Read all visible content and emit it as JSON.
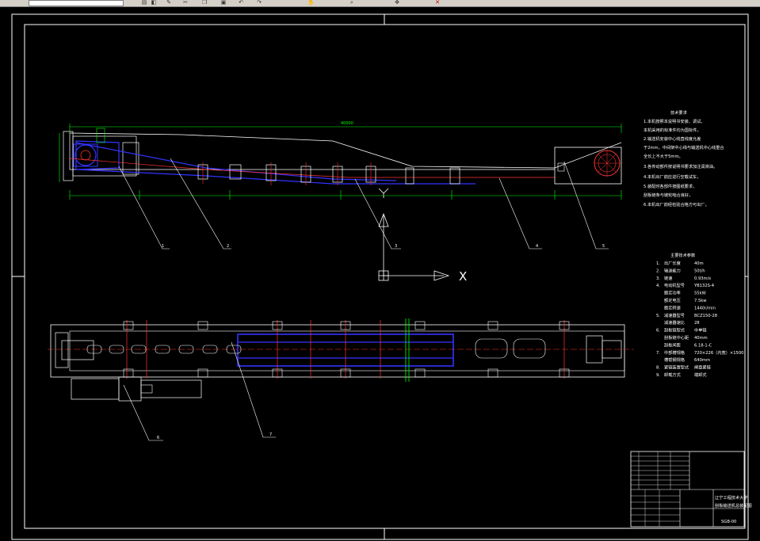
{
  "app": {
    "toolbar_icons": [
      "layer-icon",
      "properties-icon",
      "match-icon",
      "cut-icon",
      "copy-icon",
      "paste-icon",
      "undo-icon",
      "redo-icon",
      "pan-icon",
      "zoom-icon",
      "move-icon",
      "erase-icon"
    ]
  },
  "drawing": {
    "overall_dim": "40000",
    "ucs_x_label": "X",
    "ucs_y_label": "Y",
    "callouts": [
      "1",
      "2",
      "3",
      "4",
      "5",
      "6",
      "7"
    ],
    "tech_title": "技术要求",
    "tech_lines": [
      "1.本机按照本说明书安装、调试、",
      "本机采用的标准件均为国标件。",
      "2.输送机安装中心线直线度允差",
      "于2mm，中间架中心线与输送机中心线重合",
      "全长上不大于5mm。",
      "3.各传动部件按说明书要求加注润滑油。",
      "4.本机出厂前应进行空载试车，",
      "5.装配时各部件按图纸要求，",
      "刮板链条与链轮啮合良好，",
      "6.本机出厂前经检验合格方可出厂。"
    ],
    "param_title": "主要技术参数",
    "params": [
      [
        "1.",
        "出厂长度",
        "40m"
      ],
      [
        "2.",
        "输送能力",
        "50t/h"
      ],
      [
        "3.",
        "链速",
        "0.93m/s"
      ],
      [
        "4.",
        "电动机型号",
        "YB132S-4"
      ],
      [
        "",
        "额定功率",
        "55kW"
      ],
      [
        "",
        "额定电压",
        "7.5kw"
      ],
      [
        "",
        "额定转速",
        "1440r/min"
      ],
      [
        "5.",
        "减速器型号",
        "BCZ150-28"
      ],
      [
        "",
        "减速器速比",
        "28"
      ],
      [
        "6.",
        "刮板链型式",
        "中单链"
      ],
      [
        "",
        "刮板链中心距",
        "40mm"
      ],
      [
        "",
        "刮板间距",
        "6.18-1-C"
      ],
      [
        "7.",
        "中部槽规格",
        "720×226（内宽）×1500"
      ],
      [
        "",
        "槽帮钢规格",
        "640mm"
      ],
      [
        "8.",
        "紧链装置型式",
        "闸盘紧链"
      ],
      [
        "9.",
        "卸载方式",
        "端卸式"
      ]
    ],
    "title_block": {
      "company": "辽宁工程技术大学",
      "title": "刮板输送机总装配图",
      "drawing_no": "SGB-00"
    }
  }
}
